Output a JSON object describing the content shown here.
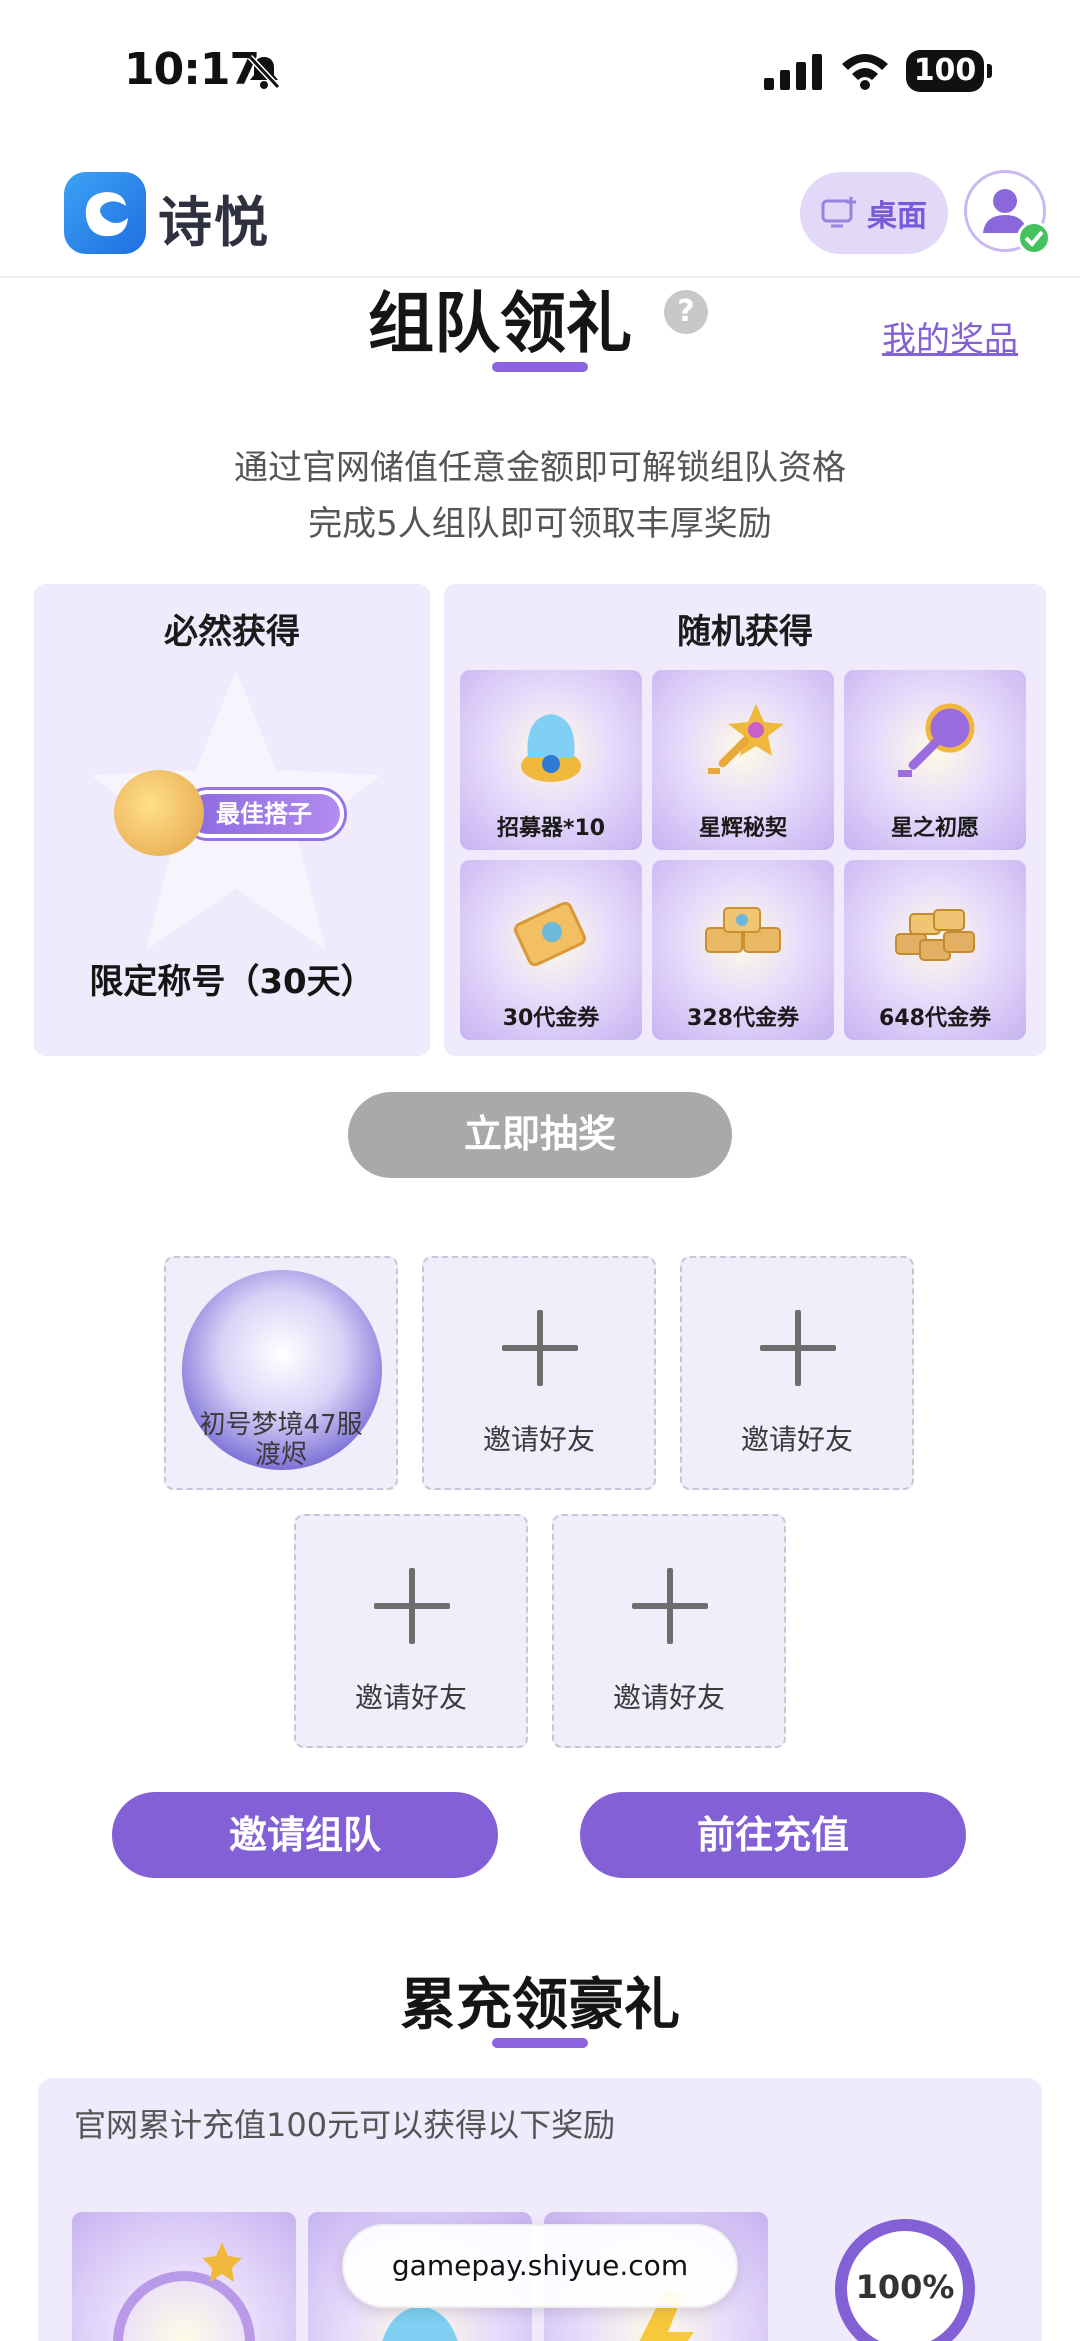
{
  "status_bar": {
    "time": "10:17",
    "battery": "100"
  },
  "header": {
    "logo_text": "诗悦",
    "desktop_label": "桌面"
  },
  "team_section": {
    "title": "组队领礼",
    "help": "?",
    "my_prizes": "我的奖品",
    "desc_line1": "通过官网储值任意金额即可解锁组队资格",
    "desc_line2": "完成5人组队即可领取丰厚奖励",
    "guaranteed": {
      "title": "必然获得",
      "badge_text": "最佳搭子",
      "label": "限定称号（30天）"
    },
    "random": {
      "title": "随机获得",
      "items": [
        {
          "label": "招募器*10",
          "icon": "recruiter-icon",
          "color": "#7fd0f2"
        },
        {
          "label": "星辉秘契",
          "icon": "star-key-icon",
          "color": "#f0b93e"
        },
        {
          "label": "星之初愿",
          "icon": "purple-key-icon",
          "color": "#9b6be0"
        },
        {
          "label": "30代金券",
          "icon": "voucher-icon",
          "color": "#f2c062"
        },
        {
          "label": "328代金券",
          "icon": "voucher-stack-icon",
          "color": "#e8b865"
        },
        {
          "label": "648代金券",
          "icon": "voucher-pile-icon",
          "color": "#e3b063"
        }
      ]
    },
    "draw_button": "立即抽奖",
    "member": {
      "name_line1": "初号梦境47服",
      "name_line2": "渡烬"
    },
    "invite_label": "邀请好友",
    "invite_team_button": "邀请组队",
    "recharge_button": "前往充值"
  },
  "cumulative_section": {
    "title": "累充领豪礼",
    "desc": "官网累计充值100元可以获得以下奖励",
    "progress": "100%",
    "progress_value": 1.0
  },
  "url_bar": {
    "url": "gamepay.shiyue.com"
  }
}
